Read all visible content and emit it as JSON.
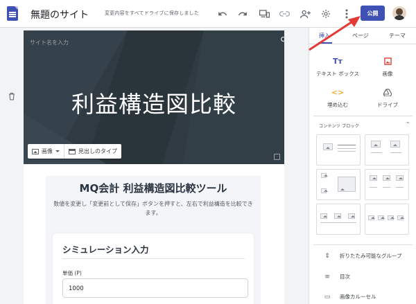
{
  "topbar": {
    "site_title": "無題のサイト",
    "save_status": "変更内容をすべてドライブに保存しました",
    "publish_label": "公開",
    "icons": [
      "undo-icon",
      "redo-icon",
      "preview-icon",
      "link-icon",
      "share-icon",
      "settings-icon",
      "more-icon"
    ]
  },
  "hero": {
    "site_name_placeholder": "サイト名を入力",
    "title": "利益構造図比較",
    "image_button": "画像",
    "header_type_button": "見出しのタイプ"
  },
  "content": {
    "tool_title": "MQ会計 利益構造図比較ツール",
    "tool_desc": "数値を変更し「変更前として保存」ボタンを押すと、左右で利益構造を比較できます。",
    "sim_title": "シミュレーション入力",
    "field_label": "単価 (P)",
    "field_value": "1000"
  },
  "panel": {
    "tabs": [
      "挿入",
      "ページ",
      "テーマ"
    ],
    "active_tab": "挿入",
    "insert_items": [
      "テキスト ボックス",
      "画像",
      "埋め込む",
      "ドライブ"
    ],
    "content_blocks_label": "コンテンツ ブロック",
    "list_items": [
      "折りたたみ可能なグループ",
      "目次",
      "画像カルーセル"
    ]
  },
  "colors": {
    "accent": "#3f51b5",
    "hero_bg": "#2f3a42",
    "arrow": "#e53935"
  }
}
